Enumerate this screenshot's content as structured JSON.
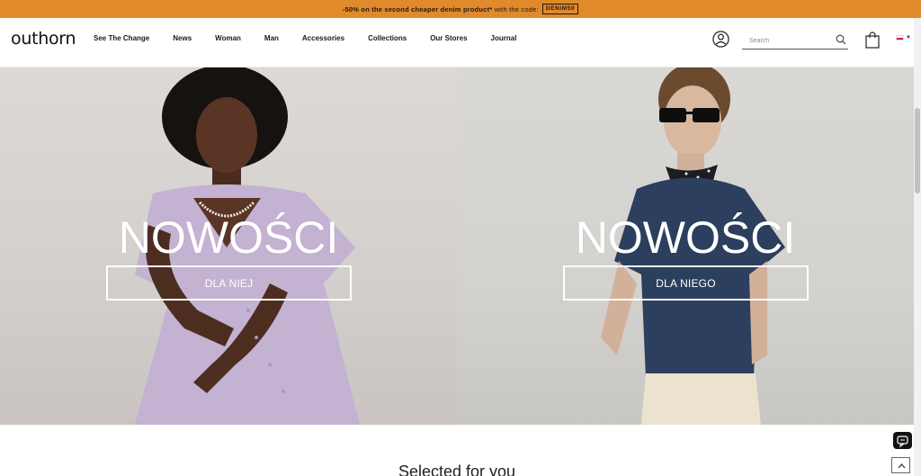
{
  "promo": {
    "bold_text": "-50% on the second cheaper denim product*",
    "normal_text": " with the code:",
    "code": "DENIM50"
  },
  "header": {
    "logo": "outhorn",
    "nav": [
      "See The Change",
      "News",
      "Woman",
      "Man",
      "Accessories",
      "Collections",
      "Our Stores",
      "Journal"
    ],
    "search_placeholder": "Search",
    "icons": {
      "account": "account-icon",
      "search": "search-icon",
      "cart": "shopping-bag-icon",
      "language": "poland-flag-icon"
    }
  },
  "hero": {
    "left": {
      "title": "NOWOŚCI",
      "button": "DLA NIEJ"
    },
    "right": {
      "title": "NOWOŚCI",
      "button": "DLA NIEGO"
    }
  },
  "section_peek": "Selected for you",
  "colors": {
    "promo_bg": "#e08a2c",
    "text": "#1a1a1a"
  }
}
